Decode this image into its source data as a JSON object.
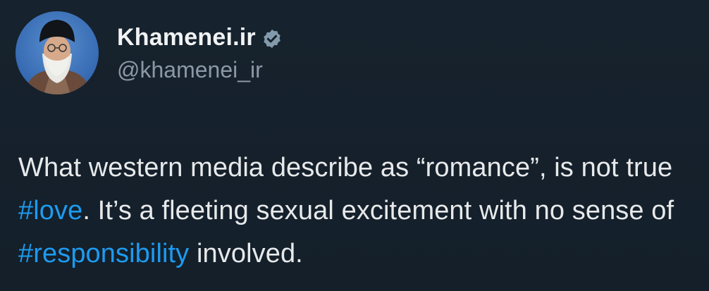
{
  "tweet": {
    "author": {
      "display_name": "Khamenei.ir",
      "handle": "@khamenei_ir",
      "verified_icon": "verified-badge-icon",
      "avatar_icon": "profile-photo"
    },
    "text_segments": [
      {
        "text": "What western media describe as “romance”, is not true ",
        "type": "text"
      },
      {
        "text": "#love",
        "type": "hashtag"
      },
      {
        "text": ". It’s a fleeting sexual excitement with no sense of ",
        "type": "text"
      },
      {
        "text": "#responsibility",
        "type": "hashtag"
      },
      {
        "text": " involved.",
        "type": "text"
      }
    ]
  },
  "colors": {
    "background": "#15202b",
    "text": "#e7e9ea",
    "handle": "#8b98a5",
    "hashtag": "#1d9bf0"
  }
}
